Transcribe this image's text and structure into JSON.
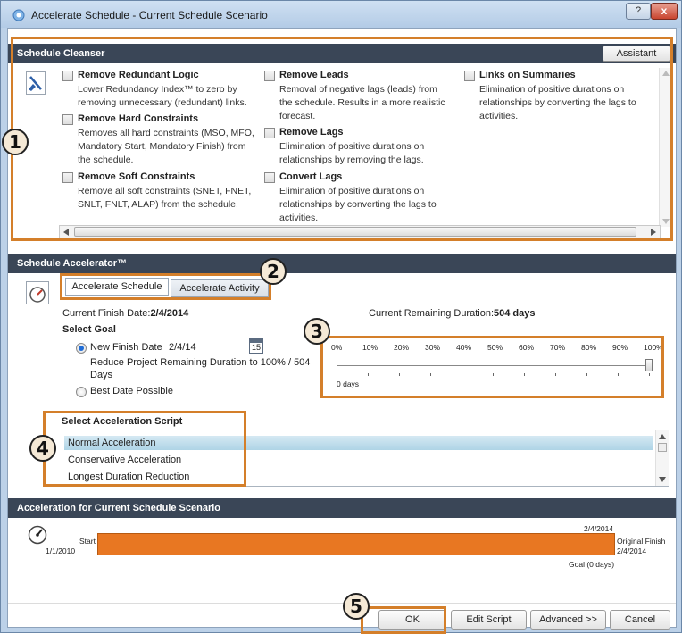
{
  "window": {
    "title": "Accelerate Schedule - Current Schedule Scenario",
    "help": "?",
    "close": "x"
  },
  "cleanser": {
    "header": "Schedule Cleanser",
    "assistant_label": "Assistant",
    "options": {
      "redundant": {
        "title": "Remove Redundant Logic",
        "desc": [
          "Lower Redundancy Index™ to zero by",
          "removing unnecessary (redundant) links."
        ]
      },
      "hard": {
        "title": "Remove Hard Constraints",
        "desc": [
          "Removes all hard constraints (MSO, MFO,",
          "Mandatory Start, Mandatory Finish) from",
          "the schedule."
        ]
      },
      "soft": {
        "title": "Remove Soft Constraints",
        "desc": [
          "Remove all soft constraints (SNET, FNET,",
          "SNLT, FNLT, ALAP) from the schedule."
        ]
      },
      "leads": {
        "title": "Remove Leads",
        "desc": [
          "Removal of negative lags (leads) from",
          "the schedule. Results in a more realistic",
          "forecast."
        ]
      },
      "lags": {
        "title": "Remove Lags",
        "desc": [
          "Elimination of positive durations on",
          "relationships by removing the lags."
        ]
      },
      "convert": {
        "title": "Convert Lags",
        "desc": [
          "Elimination of positive durations on",
          "relationships by converting the lags to",
          "activities."
        ]
      },
      "summaries": {
        "title": "Links on Summaries",
        "desc": [
          "Elimination of positive durations on",
          "relationships by converting the lags to",
          "activities."
        ]
      }
    }
  },
  "accelerator": {
    "header": "Schedule Accelerator™",
    "tabs": [
      "Accelerate Schedule",
      "Accelerate Activity"
    ],
    "current_finish_label": "Current Finish Date:",
    "current_finish_value": "2/4/2014",
    "remaining_label": "Current Remaining Duration:",
    "remaining_value": "504 days",
    "select_goal": "Select Goal",
    "new_finish_label": "New Finish Date",
    "new_finish_value": "2/4/14",
    "calendar_day": "15",
    "reduce_text": [
      "Reduce Project Remaining Duration to 100% / 504",
      "Days"
    ],
    "best_date": "Best Date Possible",
    "slider_labels": [
      "0%",
      "10%",
      "20%",
      "30%",
      "40%",
      "50%",
      "60%",
      "70%",
      "80%",
      "90%",
      "100%"
    ],
    "slider_value_percent": 100,
    "slider_days": "0 days",
    "script_header": "Select Acceleration Script",
    "scripts": [
      "Normal Acceleration",
      "Conservative Acceleration",
      "Longest Duration Reduction"
    ],
    "selected_script": 0
  },
  "scenario": {
    "header": "Acceleration for Current Schedule Scenario",
    "start_label": "Start",
    "start_date": "1/1/2010",
    "bar_end_date": "2/4/2014",
    "original_finish_label": "Original Finish",
    "original_finish_date": "2/4/2014",
    "goal_label": "Goal (0 days)"
  },
  "buttons": {
    "ok": "OK",
    "edit": "Edit Script",
    "advanced": "Advanced >>",
    "cancel": "Cancel"
  },
  "callouts": [
    "1",
    "2",
    "3",
    "4",
    "5"
  ],
  "colors": {
    "accent": "#d47f2a",
    "bar": "#e87722",
    "header": "#3a4657"
  }
}
